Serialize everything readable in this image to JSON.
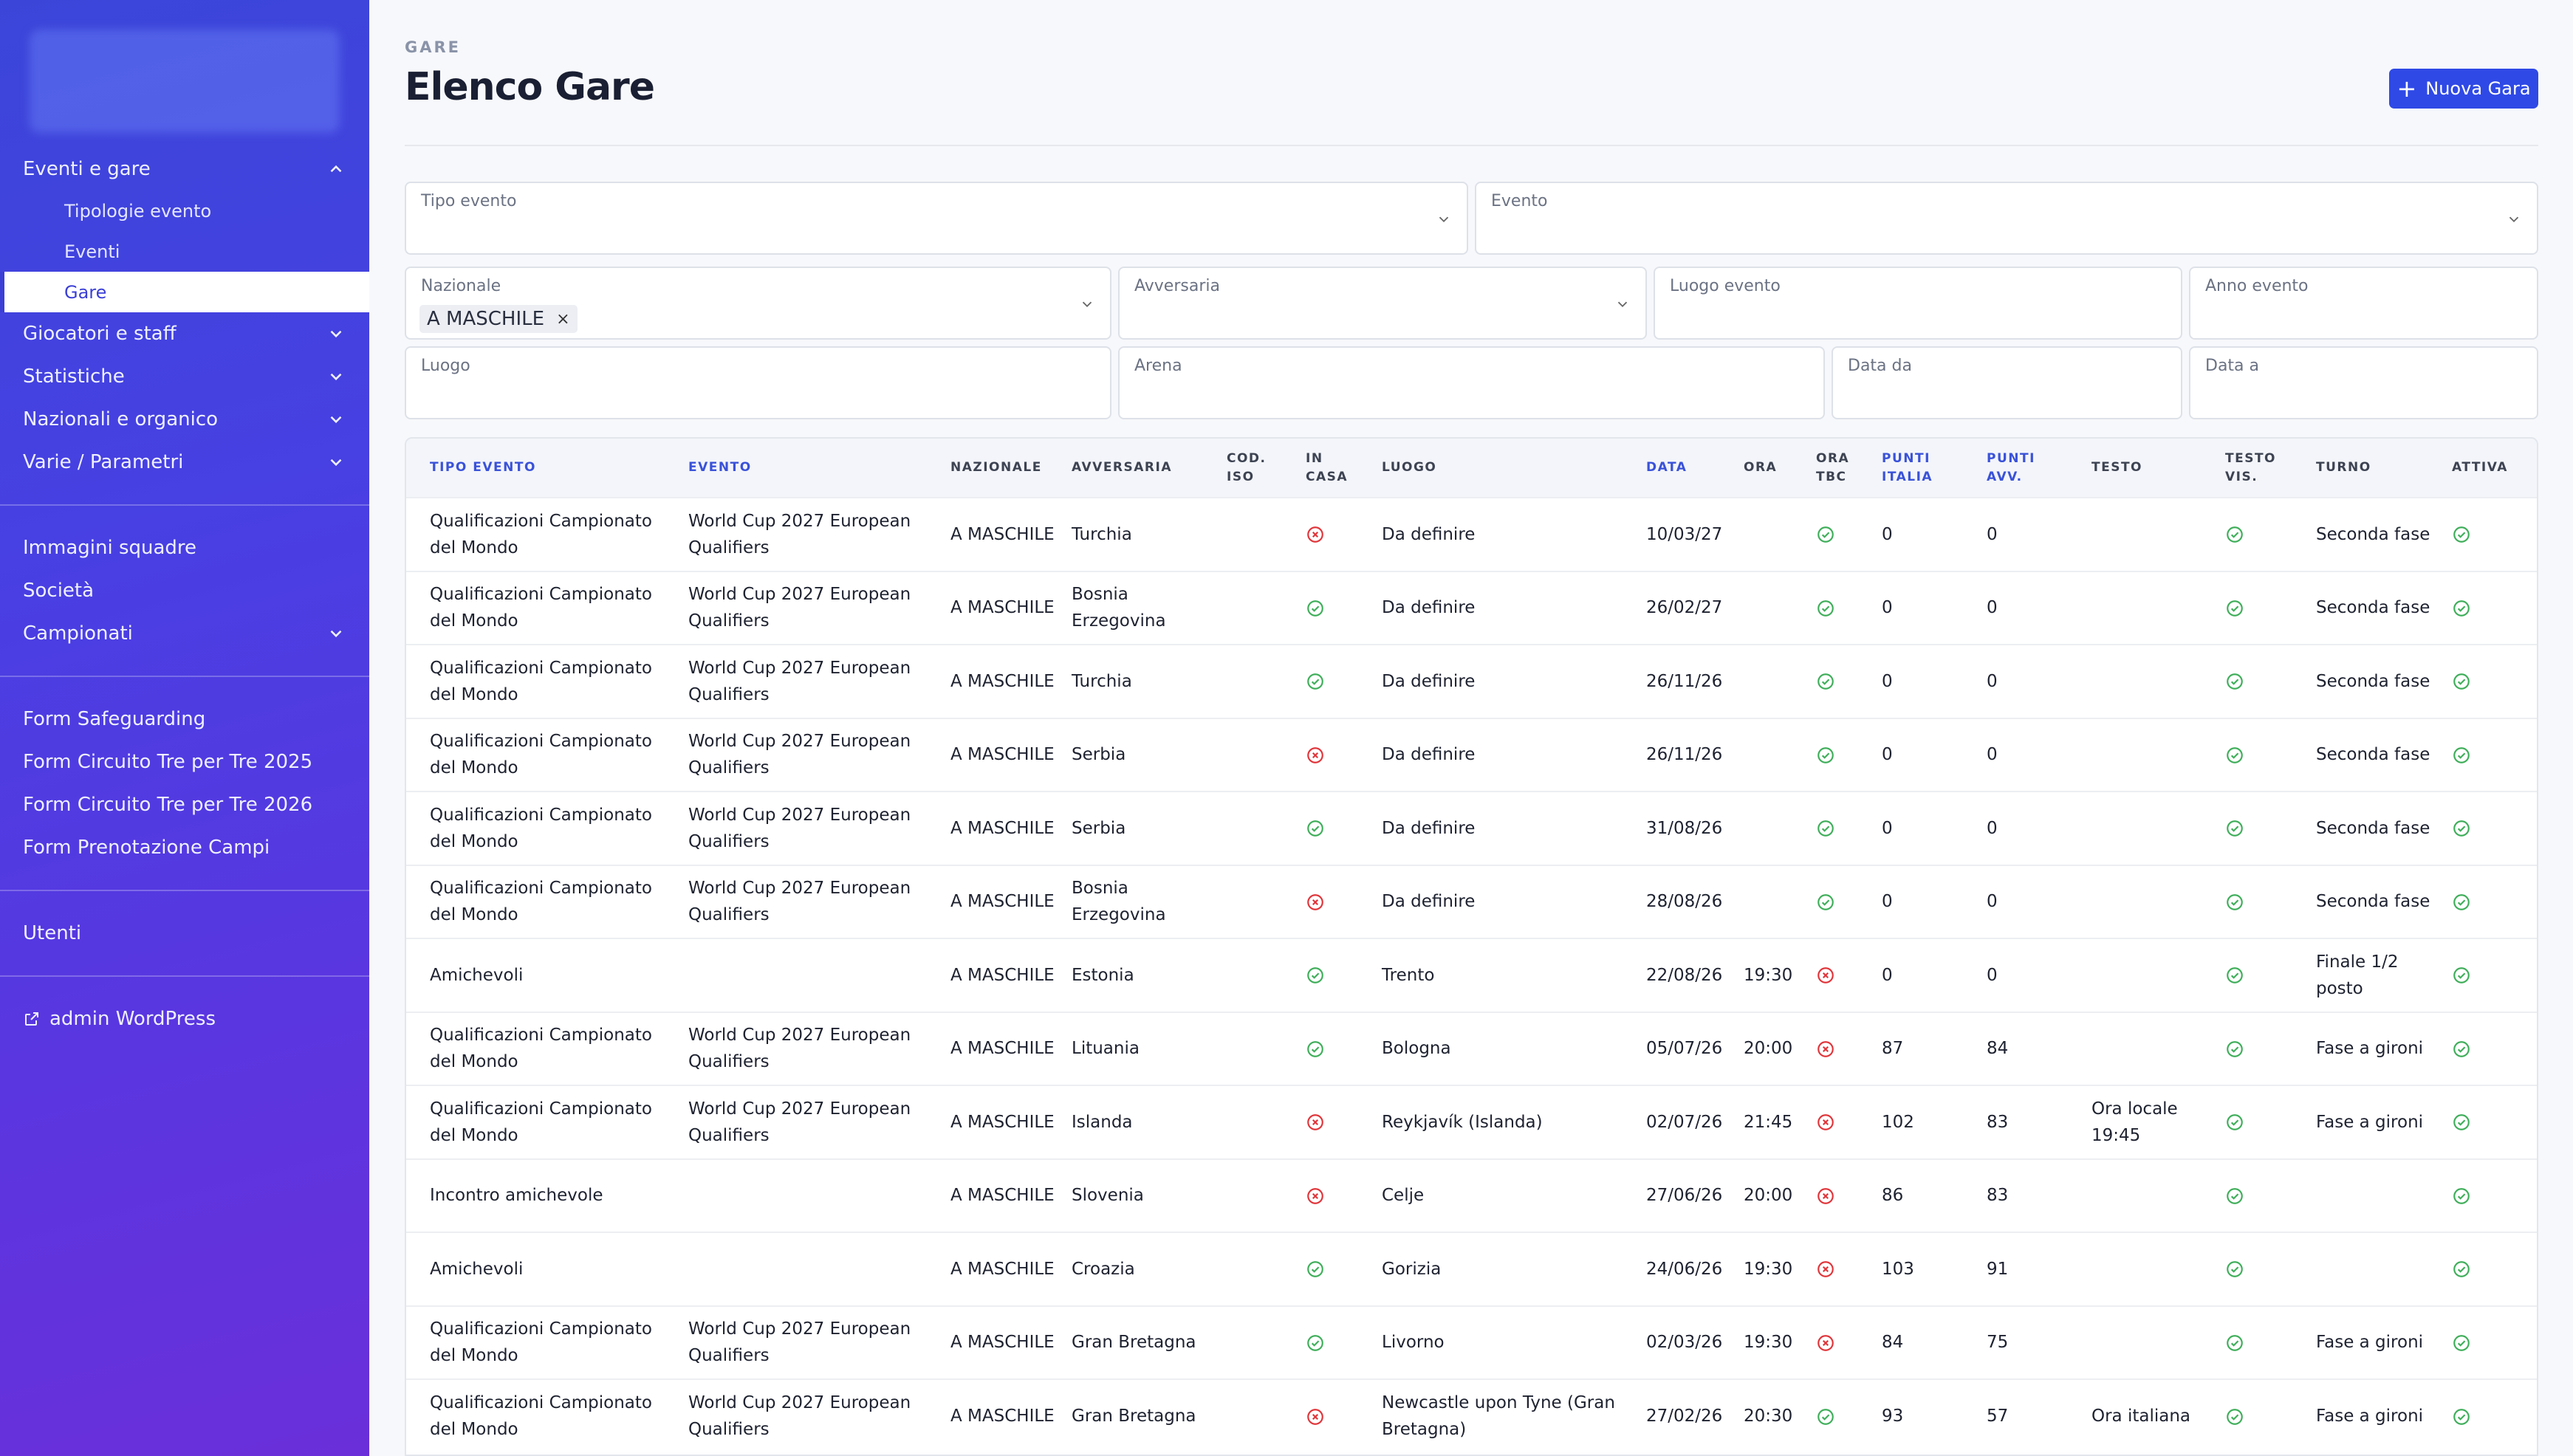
{
  "sidebar": {
    "groups": [
      {
        "label": "Eventi e gare",
        "expanded": true,
        "children": [
          {
            "label": "Tipologie evento",
            "active": false
          },
          {
            "label": "Eventi",
            "active": false
          },
          {
            "label": "Gare",
            "active": true
          }
        ]
      },
      {
        "label": "Giocatori e staff",
        "expanded": false
      },
      {
        "label": "Statistiche",
        "expanded": false
      },
      {
        "label": "Nazionali e organico",
        "expanded": false
      },
      {
        "label": "Varie / Parametri",
        "expanded": false
      }
    ],
    "section2": [
      "Immagini squadre",
      "Società"
    ],
    "campionati": "Campionati",
    "section3": [
      "Form Safeguarding",
      "Form Circuito Tre per Tre 2025",
      "Form Circuito Tre per Tre 2026",
      "Form Prenotazione Campi"
    ],
    "utenti": "Utenti",
    "wp_link": "admin WordPress"
  },
  "header": {
    "breadcrumb": "GARE",
    "title": "Elenco Gare",
    "new_button": "Nuova Gara"
  },
  "filters": {
    "tipo_evento": "Tipo evento",
    "evento": "Evento",
    "nazionale": "Nazionale",
    "nazionale_chip": "A MASCHILE",
    "avversaria": "Avversaria",
    "luogo_evento": "Luogo evento",
    "anno_evento": "Anno evento",
    "luogo": "Luogo",
    "arena": "Arena",
    "data_da": "Data da",
    "data_a": "Data a"
  },
  "table": {
    "headers": {
      "tipo": "TIPO EVENTO",
      "evento": "EVENTO",
      "nazionale": "NAZIONALE",
      "avversaria": "AVVERSARIA",
      "iso_1": "COD.",
      "iso_2": "ISO",
      "casa_1": "IN",
      "casa_2": "CASA",
      "luogo": "LUOGO",
      "data": "DATA",
      "ora": "ORA",
      "tbc_1": "ORA",
      "tbc_2": "TBC",
      "pi_1": "PUNTI",
      "pi_2": "ITALIA",
      "pa_1": "PUNTI",
      "pa_2": "AVV.",
      "testo": "TESTO",
      "tv_1": "TESTO",
      "tv_2": "VIS.",
      "turno": "TURNO",
      "attiva": "ATTIVA"
    },
    "rows": [
      {
        "tipo": "Qualificazioni Campionato del Mondo",
        "evento": "World Cup 2027 European Qualifiers",
        "nazionale": "A MASCHILE",
        "avversaria": "Turchia",
        "iso": "",
        "in_casa": false,
        "luogo": "Da definire",
        "data": "10/03/27",
        "ora": "",
        "ora_tbc": true,
        "punti_italia": "0",
        "punti_avv": "0",
        "testo": "",
        "testo_vis": true,
        "turno": "Seconda fase",
        "attiva": true
      },
      {
        "tipo": "Qualificazioni Campionato del Mondo",
        "evento": "World Cup 2027 European Qualifiers",
        "nazionale": "A MASCHILE",
        "avversaria": "Bosnia Erzegovina",
        "iso": "",
        "in_casa": true,
        "luogo": "Da definire",
        "data": "26/02/27",
        "ora": "",
        "ora_tbc": true,
        "punti_italia": "0",
        "punti_avv": "0",
        "testo": "",
        "testo_vis": true,
        "turno": "Seconda fase",
        "attiva": true
      },
      {
        "tipo": "Qualificazioni Campionato del Mondo",
        "evento": "World Cup 2027 European Qualifiers",
        "nazionale": "A MASCHILE",
        "avversaria": "Turchia",
        "iso": "",
        "in_casa": true,
        "luogo": "Da definire",
        "data": "26/11/26",
        "ora": "",
        "ora_tbc": true,
        "punti_italia": "0",
        "punti_avv": "0",
        "testo": "",
        "testo_vis": true,
        "turno": "Seconda fase",
        "attiva": true
      },
      {
        "tipo": "Qualificazioni Campionato del Mondo",
        "evento": "World Cup 2027 European Qualifiers",
        "nazionale": "A MASCHILE",
        "avversaria": "Serbia",
        "iso": "",
        "in_casa": false,
        "luogo": "Da definire",
        "data": "26/11/26",
        "ora": "",
        "ora_tbc": true,
        "punti_italia": "0",
        "punti_avv": "0",
        "testo": "",
        "testo_vis": true,
        "turno": "Seconda fase",
        "attiva": true
      },
      {
        "tipo": "Qualificazioni Campionato del Mondo",
        "evento": "World Cup 2027 European Qualifiers",
        "nazionale": "A MASCHILE",
        "avversaria": "Serbia",
        "iso": "",
        "in_casa": true,
        "luogo": "Da definire",
        "data": "31/08/26",
        "ora": "",
        "ora_tbc": true,
        "punti_italia": "0",
        "punti_avv": "0",
        "testo": "",
        "testo_vis": true,
        "turno": "Seconda fase",
        "attiva": true
      },
      {
        "tipo": "Qualificazioni Campionato del Mondo",
        "evento": "World Cup 2027 European Qualifiers",
        "nazionale": "A MASCHILE",
        "avversaria": "Bosnia Erzegovina",
        "iso": "",
        "in_casa": false,
        "luogo": "Da definire",
        "data": "28/08/26",
        "ora": "",
        "ora_tbc": true,
        "punti_italia": "0",
        "punti_avv": "0",
        "testo": "",
        "testo_vis": true,
        "turno": "Seconda fase",
        "attiva": true
      },
      {
        "tipo": "Amichevoli",
        "evento": "",
        "nazionale": "A MASCHILE",
        "avversaria": "Estonia",
        "iso": "",
        "in_casa": true,
        "luogo": "Trento",
        "data": "22/08/26",
        "ora": "19:30",
        "ora_tbc": false,
        "punti_italia": "0",
        "punti_avv": "0",
        "testo": "",
        "testo_vis": true,
        "turno": "Finale 1/2 posto",
        "attiva": true
      },
      {
        "tipo": "Qualificazioni Campionato del Mondo",
        "evento": "World Cup 2027 European Qualifiers",
        "nazionale": "A MASCHILE",
        "avversaria": "Lituania",
        "iso": "",
        "in_casa": true,
        "luogo": "Bologna",
        "data": "05/07/26",
        "ora": "20:00",
        "ora_tbc": false,
        "punti_italia": "87",
        "punti_avv": "84",
        "testo": "",
        "testo_vis": true,
        "turno": "Fase a gironi",
        "attiva": true
      },
      {
        "tipo": "Qualificazioni Campionato del Mondo",
        "evento": "World Cup 2027 European Qualifiers",
        "nazionale": "A MASCHILE",
        "avversaria": "Islanda",
        "iso": "",
        "in_casa": false,
        "luogo": "Reykjavík (Islanda)",
        "data": "02/07/26",
        "ora": "21:45",
        "ora_tbc": false,
        "punti_italia": "102",
        "punti_avv": "83",
        "testo": "Ora locale 19:45",
        "testo_vis": true,
        "turno": "Fase a gironi",
        "attiva": true
      },
      {
        "tipo": "Incontro amichevole",
        "evento": "",
        "nazionale": "A MASCHILE",
        "avversaria": "Slovenia",
        "iso": "",
        "in_casa": false,
        "luogo": "Celje",
        "data": "27/06/26",
        "ora": "20:00",
        "ora_tbc": false,
        "punti_italia": "86",
        "punti_avv": "83",
        "testo": "",
        "testo_vis": true,
        "turno": "",
        "attiva": true
      },
      {
        "tipo": "Amichevoli",
        "evento": "",
        "nazionale": "A MASCHILE",
        "avversaria": "Croazia",
        "iso": "",
        "in_casa": true,
        "luogo": "Gorizia",
        "data": "24/06/26",
        "ora": "19:30",
        "ora_tbc": false,
        "punti_italia": "103",
        "punti_avv": "91",
        "testo": "",
        "testo_vis": true,
        "turno": "",
        "attiva": true
      },
      {
        "tipo": "Qualificazioni Campionato del Mondo",
        "evento": "World Cup 2027 European Qualifiers",
        "nazionale": "A MASCHILE",
        "avversaria": "Gran Bretagna",
        "iso": "",
        "in_casa": true,
        "luogo": "Livorno",
        "data": "02/03/26",
        "ora": "19:30",
        "ora_tbc": false,
        "punti_italia": "84",
        "punti_avv": "75",
        "testo": "",
        "testo_vis": true,
        "turno": "Fase a gironi",
        "attiva": true
      },
      {
        "tipo": "Qualificazioni Campionato del Mondo",
        "evento": "World Cup 2027 European Qualifiers",
        "nazionale": "A MASCHILE",
        "avversaria": "Gran Bretagna",
        "iso": "",
        "in_casa": false,
        "luogo": "Newcastle upon Tyne (Gran Bretagna)",
        "data": "27/02/26",
        "ora": "20:30",
        "ora_tbc": true,
        "punti_italia": "93",
        "punti_avv": "57",
        "testo": "Ora italiana",
        "testo_vis": true,
        "turno": "Fase a gironi",
        "attiva": true
      }
    ]
  },
  "colors": {
    "accent": "#2f49e6",
    "check": "#3fae5a",
    "cross": "#e0353a",
    "sidebar_top": "#3b46d9",
    "sidebar_bottom": "#6a2fd9"
  }
}
